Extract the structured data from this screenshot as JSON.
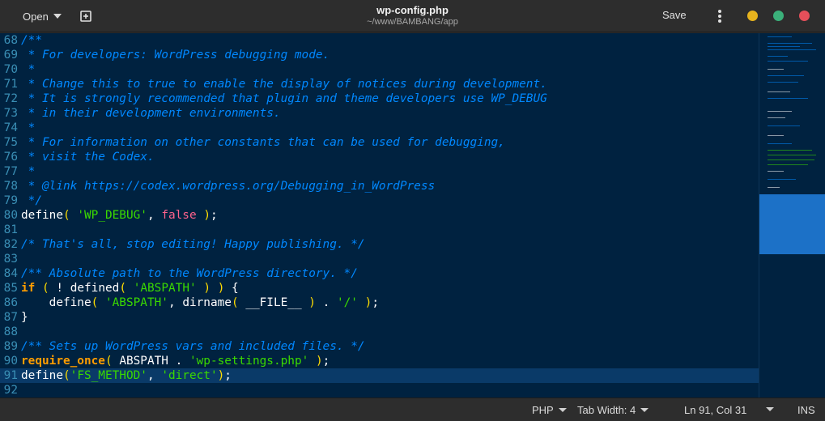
{
  "header": {
    "open_label": "Open",
    "title": "wp-config.php",
    "subtitle": "~/www/BAMBANG/app",
    "save_label": "Save"
  },
  "editor": {
    "lines": [
      {
        "n": "68",
        "html": "<span class=\"t-comment\">/**</span>"
      },
      {
        "n": "69",
        "html": "<span class=\"t-comment\"> * For developers: WordPress debugging mode.</span>"
      },
      {
        "n": "70",
        "html": "<span class=\"t-comment\"> *</span>"
      },
      {
        "n": "71",
        "html": "<span class=\"t-comment\"> * Change this to true to enable the display of notices during development.</span>"
      },
      {
        "n": "72",
        "html": "<span class=\"t-comment\"> * It is strongly recommended that plugin and theme developers use WP_DEBUG</span>"
      },
      {
        "n": "73",
        "html": "<span class=\"t-comment\"> * in their development environments.</span>"
      },
      {
        "n": "74",
        "html": "<span class=\"t-comment\"> *</span>"
      },
      {
        "n": "75",
        "html": "<span class=\"t-comment\"> * For information on other constants that can be used for debugging,</span>"
      },
      {
        "n": "76",
        "html": "<span class=\"t-comment\"> * visit the Codex.</span>"
      },
      {
        "n": "77",
        "html": "<span class=\"t-comment\"> *</span>"
      },
      {
        "n": "78",
        "html": "<span class=\"t-comment\"> * @link https://codex.wordpress.org/Debugging_in_WordPress</span>"
      },
      {
        "n": "79",
        "html": "<span class=\"t-comment\"> */</span>"
      },
      {
        "n": "80",
        "html": "<span class=\"t-fn\">define</span><span class=\"t-paren\">(</span> <span class=\"t-str\">'WP_DEBUG'</span><span class=\"t-plain\">,</span> <span class=\"t-bool\">false</span> <span class=\"t-paren\">)</span><span class=\"t-plain\">;</span>"
      },
      {
        "n": "81",
        "html": ""
      },
      {
        "n": "82",
        "html": "<span class=\"t-comment\">/* That's all, stop editing! Happy publishing. */</span>"
      },
      {
        "n": "83",
        "html": ""
      },
      {
        "n": "84",
        "html": "<span class=\"t-comment\">/** Absolute path to the WordPress directory. */</span>"
      },
      {
        "n": "85",
        "html": "<span class=\"t-kw\">if</span> <span class=\"t-paren\">(</span> <span class=\"t-plain\">!</span> <span class=\"t-fn\">defined</span><span class=\"t-paren\">(</span> <span class=\"t-str\">'ABSPATH'</span> <span class=\"t-paren\">)</span> <span class=\"t-paren\">)</span> <span class=\"t-plain\">{</span>"
      },
      {
        "n": "86",
        "html": "    <span class=\"t-fn\">define</span><span class=\"t-paren\">(</span> <span class=\"t-str\">'ABSPATH'</span><span class=\"t-plain\">,</span> <span class=\"t-fn\">dirname</span><span class=\"t-paren\">(</span> <span class=\"t-plain\">__FILE__</span> <span class=\"t-paren\">)</span> <span class=\"t-plain\">.</span> <span class=\"t-str\">'/'</span> <span class=\"t-paren\">)</span><span class=\"t-plain\">;</span>"
      },
      {
        "n": "87",
        "html": "<span class=\"t-plain\">}</span>"
      },
      {
        "n": "88",
        "html": ""
      },
      {
        "n": "89",
        "html": "<span class=\"t-comment\">/** Sets up WordPress vars and included files. */</span>"
      },
      {
        "n": "90",
        "html": "<span class=\"t-kw\">require_once</span><span class=\"t-paren\">(</span> <span class=\"t-plain\">ABSPATH</span> <span class=\"t-plain\">.</span> <span class=\"t-str\">'wp-settings.php'</span> <span class=\"t-paren\">)</span><span class=\"t-plain\">;</span>"
      },
      {
        "n": "91",
        "html": "<span class=\"t-fn\">define</span><span class=\"t-paren\">(</span><span class=\"t-str\">'FS_METHOD'</span><span class=\"t-plain\">,</span> <span class=\"t-str\">'direct'</span><span class=\"t-paren\">)</span><span class=\"t-plain\">;</span>",
        "current": true
      },
      {
        "n": "92",
        "html": ""
      }
    ]
  },
  "statusbar": {
    "language": "PHP",
    "tab_width": "Tab Width: 4",
    "position": "Ln 91, Col 31",
    "mode": "INS"
  },
  "colors": {
    "editor_bg": "#002240",
    "current_line": "#0a3a68",
    "comment": "#0088ff",
    "string": "#3ad900",
    "keyword": "#ff9d00",
    "boolean": "#ff628c",
    "paren": "#ffdd00"
  }
}
